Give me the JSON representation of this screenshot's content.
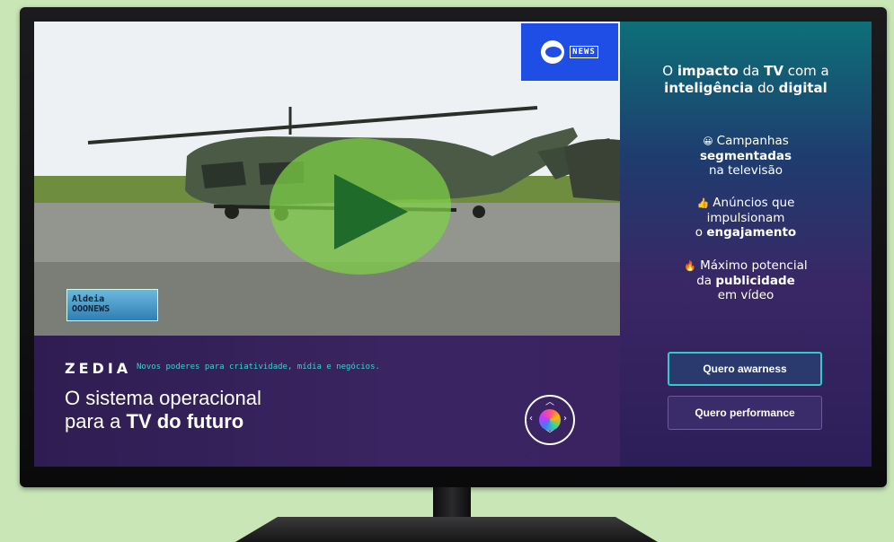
{
  "video": {
    "overlay_text": "",
    "news_logo_text": "NEWS",
    "channel_logo_line1": "Aldeia",
    "channel_logo_line2": "OOONEWS"
  },
  "banner": {
    "brand": "ZEDIA",
    "tagline": "Novos poderes para criatividade, mídia e negócios.",
    "headline_line1": "O sistema operacional",
    "headline_line2_prefix": "para a ",
    "headline_line2_bold": "TV do futuro"
  },
  "panel": {
    "heading": {
      "p1": "O ",
      "b1": "impacto",
      "p2": " da ",
      "b2": "TV",
      "p3": " com a",
      "b3": "inteligência",
      "p4": " do ",
      "b4": "digital"
    },
    "features": [
      {
        "icon": "smiley-icon",
        "glyph": "😀",
        "line1": "Campanhas",
        "line2_bold": "segmentadas",
        "line3": "na televisão"
      },
      {
        "icon": "thumbs-up-icon",
        "glyph": "👍",
        "line1": "Anúncios que",
        "line2": "impulsionam",
        "line3_prefix": "o ",
        "line3_bold": "engajamento"
      },
      {
        "icon": "fire-icon",
        "glyph": "🔥",
        "line1": "Máximo potencial",
        "line2_prefix": "da ",
        "line2_bold": "publicidade",
        "line3": "em vídeo"
      }
    ],
    "buttons": {
      "awareness": "Quero awarness",
      "performance": "Quero performance"
    }
  },
  "colors": {
    "background": "#c9e7b6",
    "accent_teal": "#35c8c6",
    "play_green": "#80d246",
    "news_blue": "#1f4ee6"
  }
}
